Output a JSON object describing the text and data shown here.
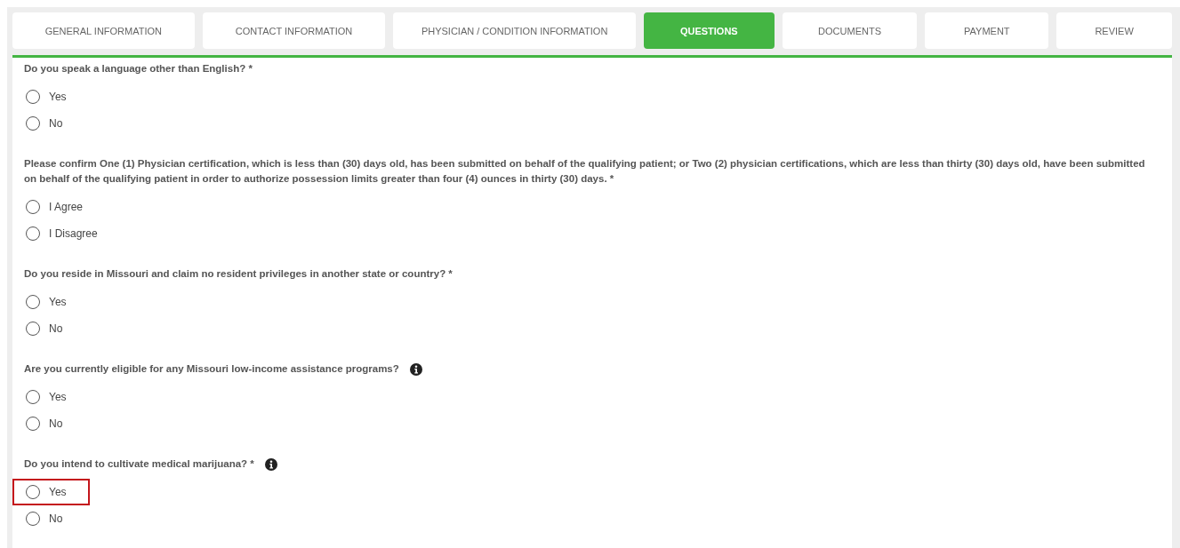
{
  "tabs": [
    {
      "label": "GENERAL INFORMATION",
      "selected": false
    },
    {
      "label": "CONTACT INFORMATION",
      "selected": false
    },
    {
      "label": "PHYSICIAN / CONDITION INFORMATION",
      "selected": false
    },
    {
      "label": "QUESTIONS",
      "selected": true
    },
    {
      "label": "DOCUMENTS",
      "selected": false
    },
    {
      "label": "PAYMENT",
      "selected": false
    },
    {
      "label": "REVIEW",
      "selected": false
    }
  ],
  "questions": [
    {
      "text": "Do you speak a language other than English? *",
      "info": false,
      "options": [
        {
          "label": "Yes",
          "selected": false,
          "highlighted": false
        },
        {
          "label": "No",
          "selected": false,
          "highlighted": false
        }
      ]
    },
    {
      "text": "Please confirm One (1) Physician certification, which is less than (30) days old, has been submitted on behalf of the qualifying patient; or Two (2) physician certifications, which are less than thirty (30) days old, have been submitted on behalf of the qualifying patient in order to authorize possession limits greater than four (4) ounces in thirty (30) days. *",
      "info": false,
      "options": [
        {
          "label": "I Agree",
          "selected": false,
          "highlighted": false
        },
        {
          "label": "I Disagree",
          "selected": false,
          "highlighted": false
        }
      ]
    },
    {
      "text": "Do you reside in Missouri and claim no resident privileges in another state or country? *",
      "info": false,
      "options": [
        {
          "label": "Yes",
          "selected": false,
          "highlighted": false
        },
        {
          "label": "No",
          "selected": false,
          "highlighted": false
        }
      ]
    },
    {
      "text": "Are you currently eligible for any Missouri low-income assistance programs?",
      "info": true,
      "options": [
        {
          "label": "Yes",
          "selected": false,
          "highlighted": false
        },
        {
          "label": "No",
          "selected": false,
          "highlighted": false
        }
      ]
    },
    {
      "text": "Do you intend to cultivate medical marijuana? *",
      "info": true,
      "options": [
        {
          "label": "Yes",
          "selected": false,
          "highlighted": true
        },
        {
          "label": "No",
          "selected": false,
          "highlighted": false
        }
      ]
    }
  ]
}
